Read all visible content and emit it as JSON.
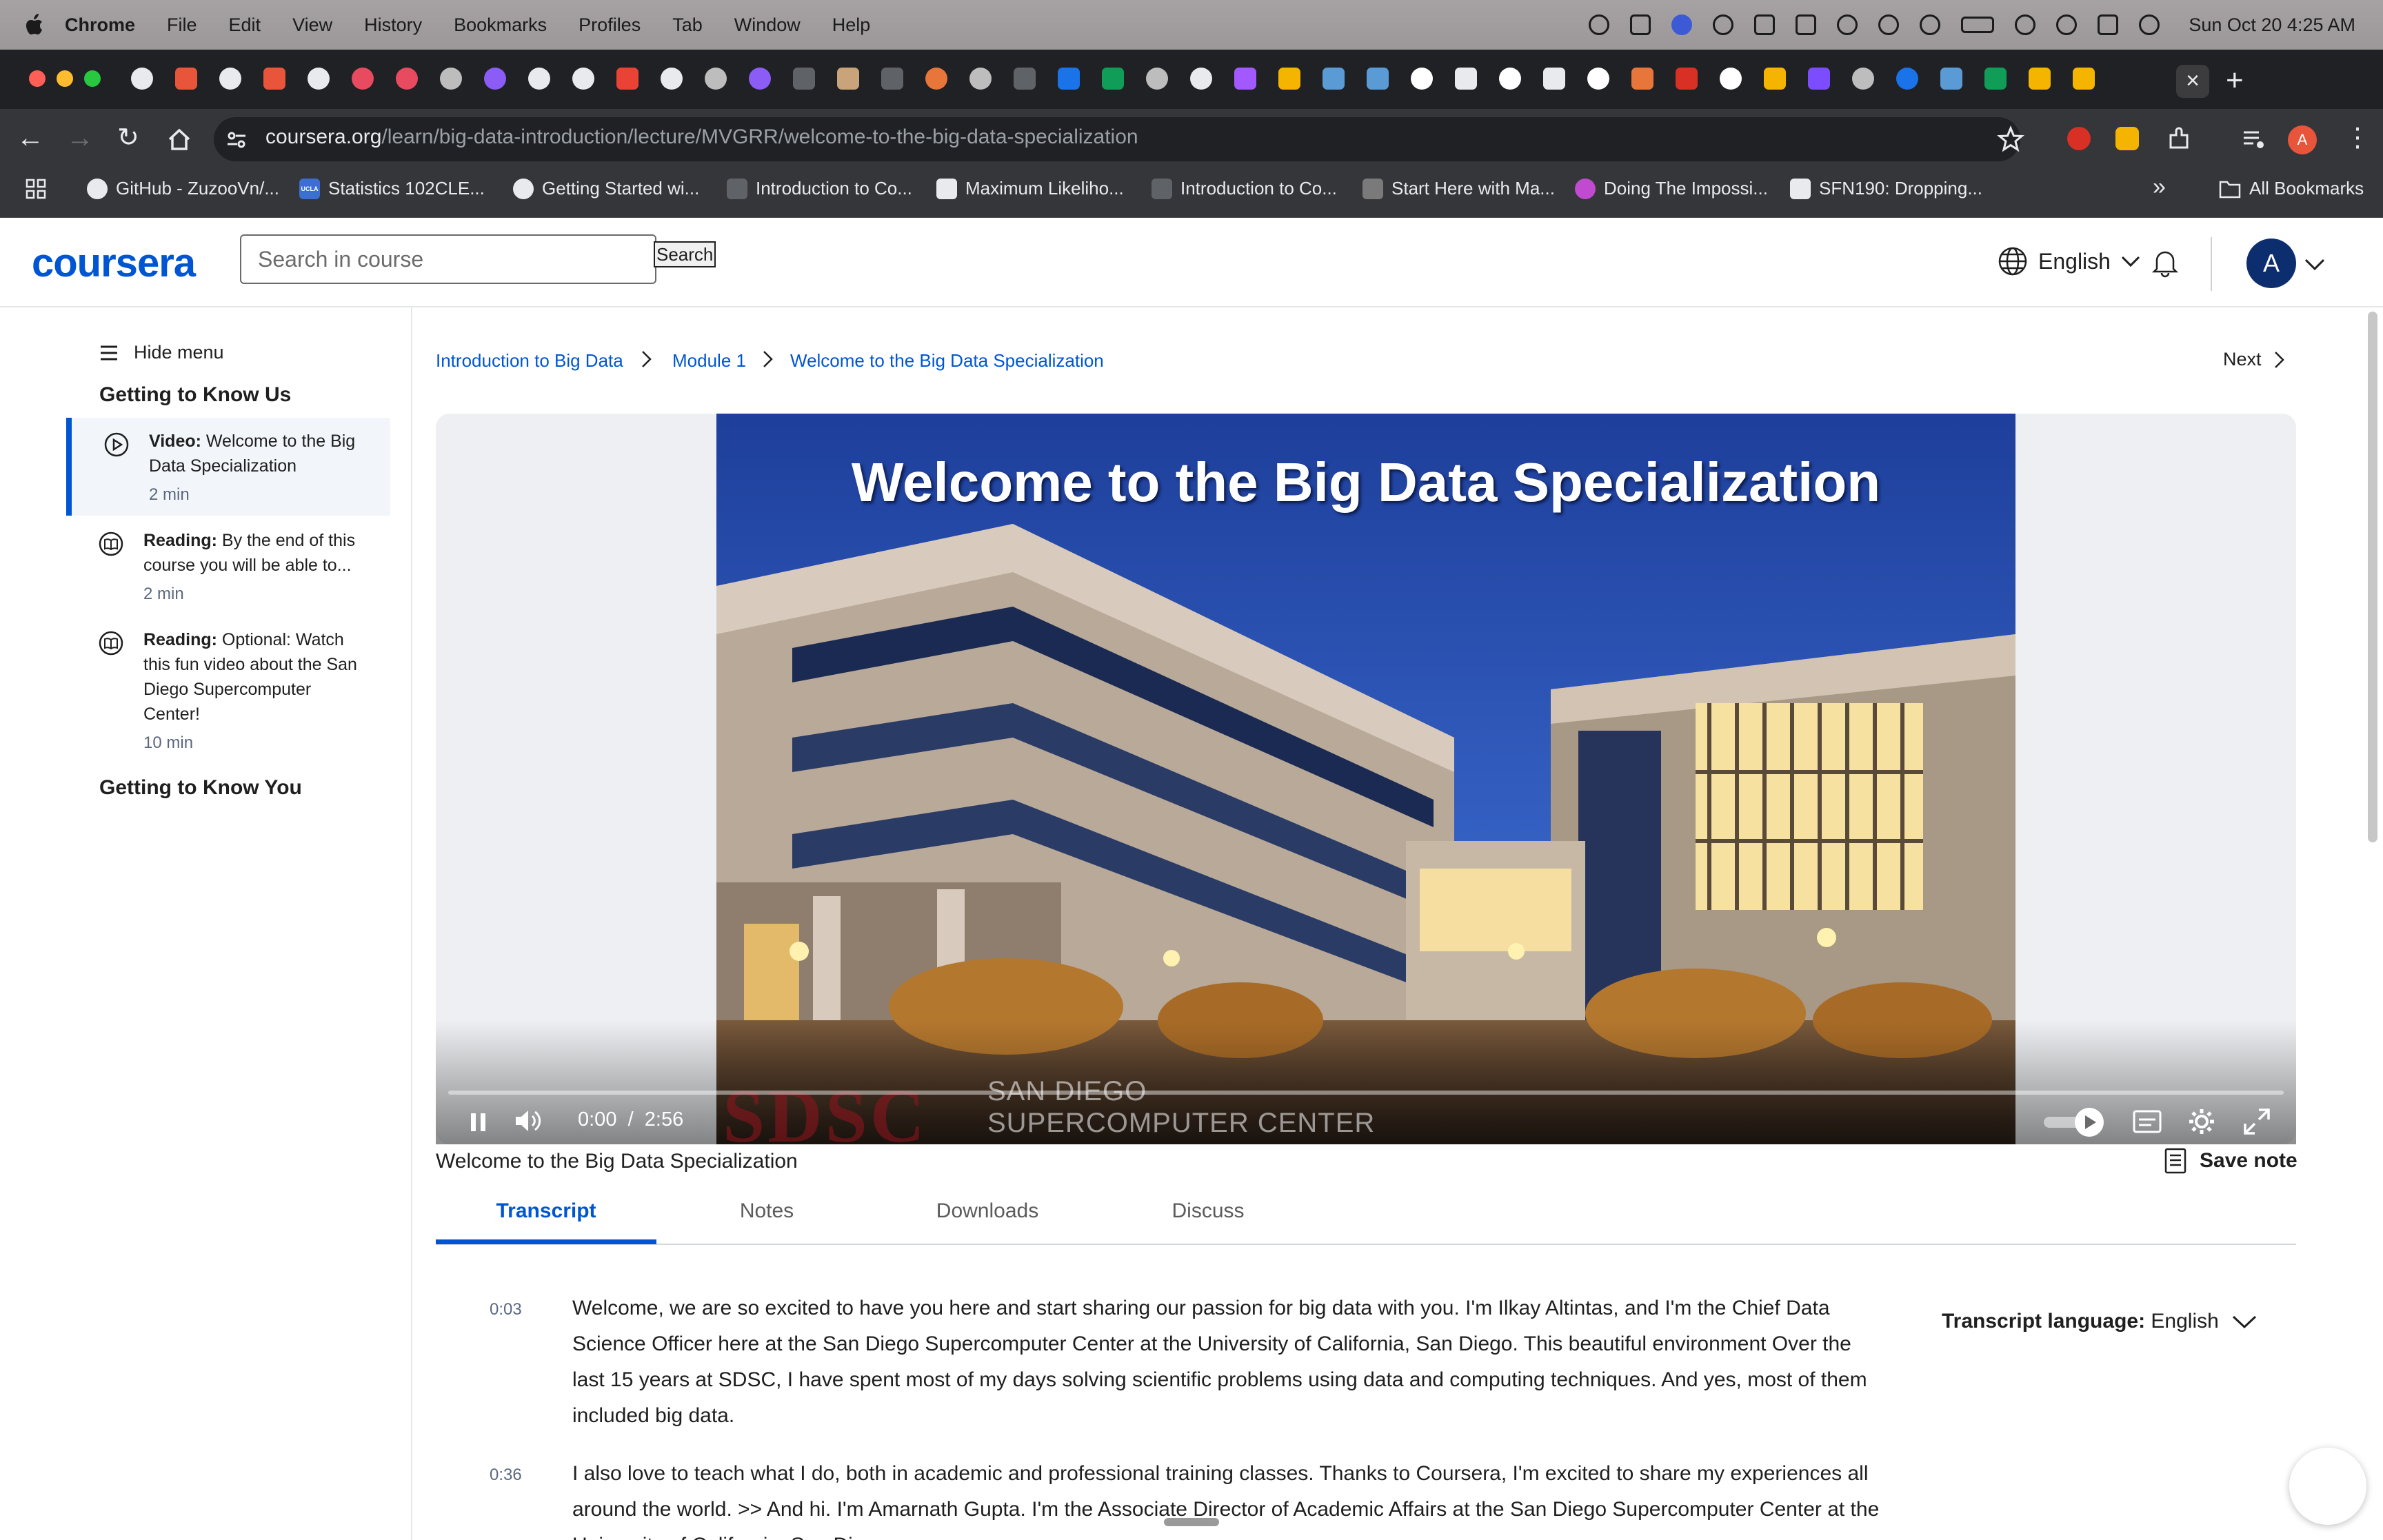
{
  "menubar": {
    "app": "Chrome",
    "items": [
      "File",
      "Edit",
      "View",
      "History",
      "Bookmarks",
      "Profiles",
      "Tab",
      "Window",
      "Help"
    ],
    "clock": "Sun Oct 20  4:25 AM"
  },
  "browser": {
    "url_host": "coursera.org",
    "url_path": "/learn/big-data-introduction/lecture/MVGRR/welcome-to-the-big-data-specialization",
    "bookmarks": [
      "GitHub - ZuzooVn/...",
      "Statistics 102CLE...",
      "Getting Started wi...",
      "Introduction to Co...",
      "Maximum Likeliho...",
      "Introduction to Co...",
      "Start Here with Ma...",
      "Doing The Impossi...",
      "SFN190: Dropping..."
    ],
    "all_bookmarks": "All Bookmarks",
    "profile_initial": "A",
    "bookmark_badge": "UCLA"
  },
  "header": {
    "logo": "coursera",
    "search_placeholder": "Search in course",
    "search_button": "Search",
    "language": "English",
    "user_initial": "A"
  },
  "sidebar": {
    "hide_menu": "Hide menu",
    "section1": "Getting to Know Us",
    "items": [
      {
        "kind": "Video:",
        "title": " Welcome to the Big Data Specialization",
        "duration": "2 min"
      },
      {
        "kind": "Reading:",
        "title": " By the end of this course you will be able to...",
        "duration": "2 min"
      },
      {
        "kind": "Reading:",
        "title": " Optional: Watch this fun video about the San Diego Supercomputer Center!",
        "duration": "10 min"
      }
    ],
    "section2": "Getting to Know You"
  },
  "breadcrumb": [
    "Introduction to Big Data",
    "Module 1",
    "Welcome to the Big Data Specialization"
  ],
  "next_label": "Next",
  "video": {
    "slide_title": "Welcome to the Big Data Specialization",
    "watermark_logo": "SDSC",
    "watermark_line1": "SAN DIEGO",
    "watermark_line2": "SUPERCOMPUTER CENTER",
    "time_current": "0:00",
    "time_separator": "/",
    "time_total": "2:56",
    "progress": 0
  },
  "video_title": "Welcome to the Big Data Specialization",
  "save_note": "Save note",
  "tabs": [
    "Transcript",
    "Notes",
    "Downloads",
    "Discuss"
  ],
  "transcript": {
    "language_label": "Transcript language:",
    "language_value": "English",
    "paragraphs": [
      {
        "time": "0:03",
        "text": "Welcome, we are so excited to have you here and start sharing our passion for big data with you. I'm Ilkay Altintas, and I'm the Chief Data Science Officer here at the San Diego Supercomputer Center at the University of California, San Diego. This beautiful environment Over the last 15 years at SDSC, I have spent most of my days solving scientific problems using data and computing techniques. And yes, most of them included big data."
      },
      {
        "time": "0:36",
        "text": "I also love to teach what I do, both in academic and professional training classes. Thanks to Coursera, I'm excited to share my experiences all around the world. >> And hi. I'm Amarnath Gupta. I'm the Associate Director of Academic Affairs at the San Diego Supercomputer Center at the University of California, San Diego."
      }
    ]
  },
  "colors": {
    "accent": "#0056d2",
    "chrome_dark": "#202124",
    "toolbar": "#35363a"
  }
}
